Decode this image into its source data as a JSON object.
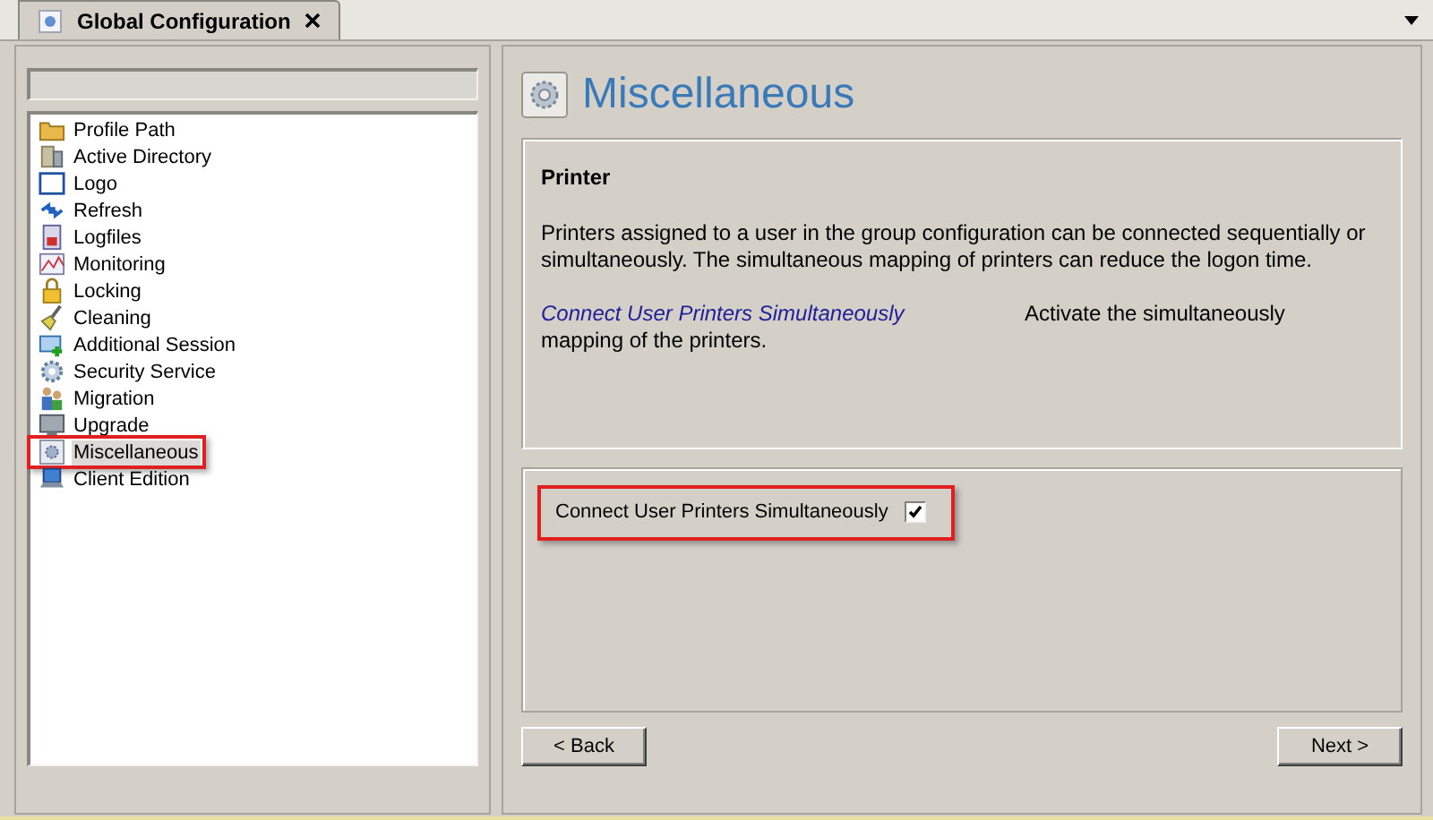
{
  "tabs": [
    {
      "label": "Global Configuration",
      "selected": true
    }
  ],
  "sidebar": {
    "items": [
      {
        "label": "Profile Path",
        "selected": false,
        "highlighted": false
      },
      {
        "label": "Active Directory",
        "selected": false,
        "highlighted": false
      },
      {
        "label": "Logo",
        "selected": false,
        "highlighted": false
      },
      {
        "label": "Refresh",
        "selected": false,
        "highlighted": false
      },
      {
        "label": "Logfiles",
        "selected": false,
        "highlighted": false
      },
      {
        "label": "Monitoring",
        "selected": false,
        "highlighted": false
      },
      {
        "label": "Locking",
        "selected": false,
        "highlighted": false
      },
      {
        "label": "Cleaning",
        "selected": false,
        "highlighted": false
      },
      {
        "label": "Additional Session",
        "selected": false,
        "highlighted": false
      },
      {
        "label": "Security Service",
        "selected": false,
        "highlighted": false
      },
      {
        "label": "Migration",
        "selected": false,
        "highlighted": false
      },
      {
        "label": "Upgrade",
        "selected": false,
        "highlighted": false
      },
      {
        "label": "Miscellaneous",
        "selected": true,
        "highlighted": true
      },
      {
        "label": "Client Edition",
        "selected": false,
        "highlighted": false
      }
    ]
  },
  "page": {
    "title": "Miscellaneous",
    "section": {
      "heading": "Printer",
      "description": "Printers assigned to a user in the group configuration can be connected sequentially or simultaneously. The simultaneous mapping of printers can reduce the logon time.",
      "option_name": "Connect User Printers Simultaneously",
      "option_description_lines": [
        "Activate the simultaneously",
        "mapping of the printers."
      ]
    },
    "options": [
      {
        "label": "Connect User Printers Simultaneously",
        "checked": true,
        "highlighted": true
      }
    ],
    "buttons": [
      "< Back",
      "Next >"
    ]
  }
}
